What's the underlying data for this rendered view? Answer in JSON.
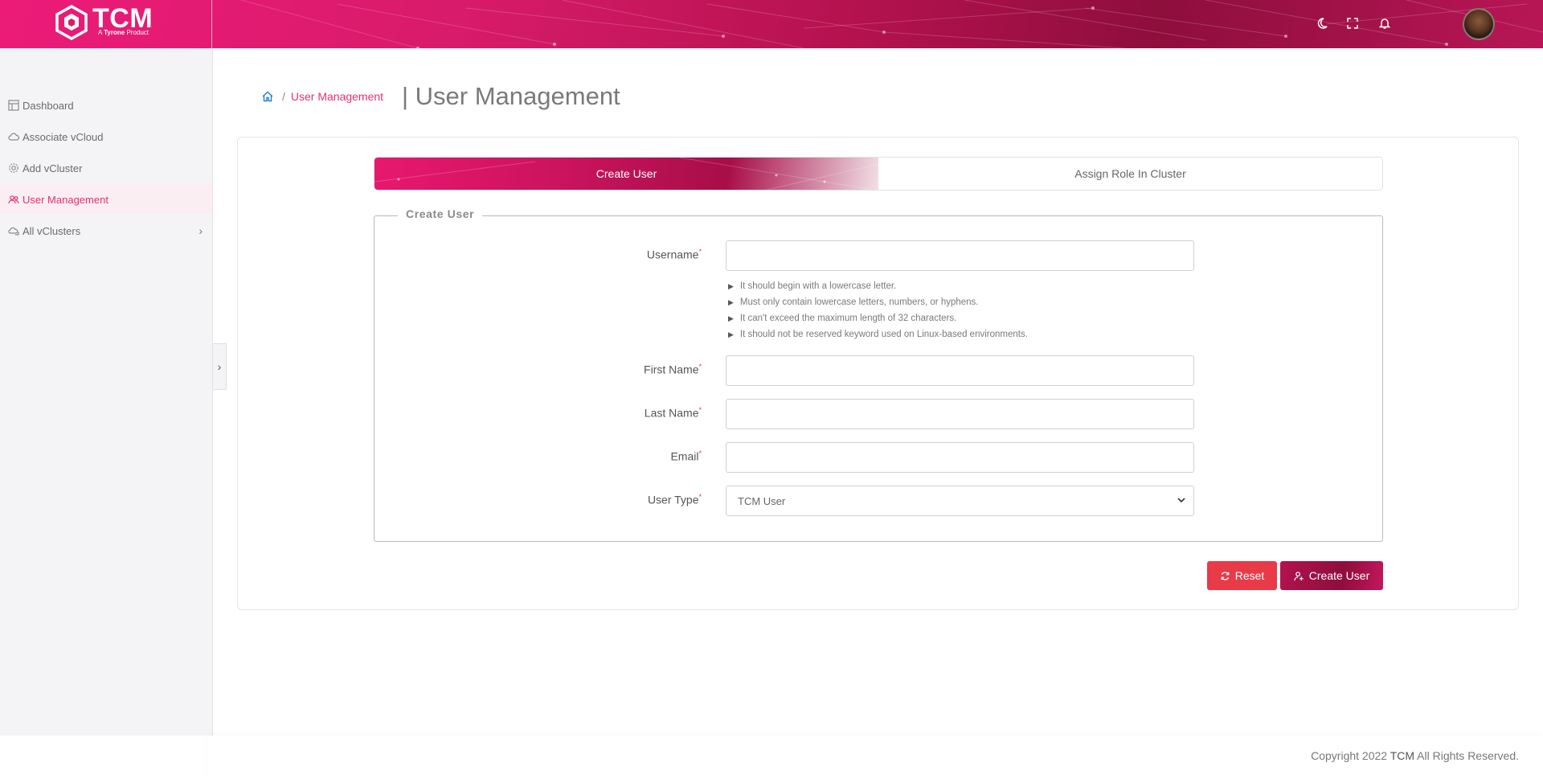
{
  "header": {
    "brand": "TCM",
    "brand_sub_prefix": "A",
    "brand_sub_name": "Tyrone",
    "brand_sub_suffix": "Product",
    "icons": [
      "moon-icon",
      "fullscreen-icon",
      "bell-icon"
    ],
    "accent": "#e8186f"
  },
  "sidebar": {
    "items": [
      {
        "label": "Dashboard",
        "icon": "dashboard-icon"
      },
      {
        "label": "Associate vCloud",
        "icon": "cloud-icon"
      },
      {
        "label": "Add vCluster",
        "icon": "gear-icon"
      },
      {
        "label": "User Management",
        "icon": "users-icon",
        "active": true
      },
      {
        "label": "All vClusters",
        "icon": "clusters-icon",
        "has_submenu": true
      }
    ]
  },
  "breadcrumb": {
    "current": "User Management",
    "separator": "/"
  },
  "page": {
    "title": "| User Management"
  },
  "tabs": [
    {
      "label": "Create User",
      "active": true
    },
    {
      "label": "Assign Role In Cluster",
      "active": false
    }
  ],
  "form": {
    "legend": "Create User",
    "username": {
      "label": "Username",
      "required": "*",
      "value": ""
    },
    "hints": [
      "It should begin with a lowercase letter.",
      "Must only contain lowercase letters, numbers, or hyphens.",
      "It can't exceed the maximum length of 32 characters.",
      "It should not be reserved keyword used on Linux-based environments."
    ],
    "first_name": {
      "label": "First Name",
      "required": "*",
      "value": ""
    },
    "last_name": {
      "label": "Last Name",
      "required": "*",
      "value": ""
    },
    "email": {
      "label": "Email",
      "required": "*",
      "value": ""
    },
    "user_type": {
      "label": "User Type",
      "required": "*",
      "value": "TCM User"
    }
  },
  "buttons": {
    "reset": "Reset",
    "create": "Create User"
  },
  "footer": {
    "prefix": "Copyright 2022",
    "brand": "TCM",
    "suffix": "All Rights Reserved."
  }
}
